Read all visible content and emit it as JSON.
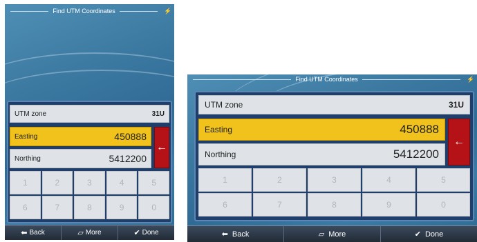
{
  "header": {
    "title": "Find UTM Coordinates",
    "status_icon": "satellite-icon"
  },
  "fields": [
    {
      "label": "UTM zone",
      "value": "31U"
    },
    {
      "label": "Easting",
      "value": "450888"
    },
    {
      "label": "Northing",
      "value": "5412200"
    }
  ],
  "keypad": {
    "keys": [
      "1",
      "2",
      "3",
      "4",
      "5",
      "6",
      "7",
      "8",
      "9",
      "0"
    ]
  },
  "active_field": "Easting",
  "toolbar": {
    "back_label": "Back",
    "more_label": "More",
    "done_label": "Done"
  },
  "colors": {
    "active_field": "#f0c21b",
    "confirm_button": "#b51218",
    "panel": "#1f3f6a"
  }
}
